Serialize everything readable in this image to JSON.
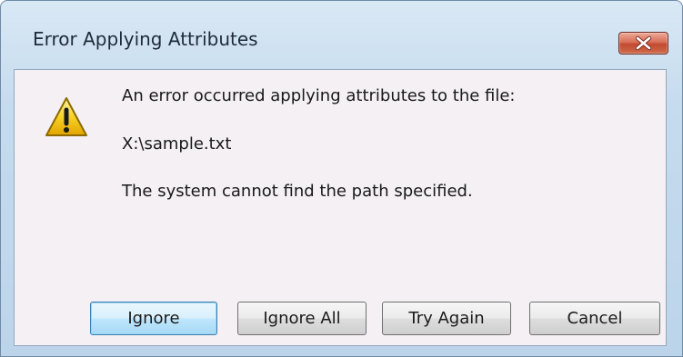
{
  "window": {
    "title": "Error Applying Attributes",
    "close_icon": "close-icon"
  },
  "message": {
    "icon": "warning-icon",
    "line1": "An error occurred applying attributes to the file:",
    "path": "X:\\sample.txt",
    "line3": "The system cannot find the path specified."
  },
  "buttons": {
    "ignore": "Ignore",
    "ignore_all": "Ignore All",
    "try_again": "Try Again",
    "cancel": "Cancel"
  },
  "colors": {
    "title_bar": "#c5dbee",
    "close_button": "#c24a31",
    "client_background": "#f4f0f4",
    "default_button_border": "#3c7fb1"
  }
}
